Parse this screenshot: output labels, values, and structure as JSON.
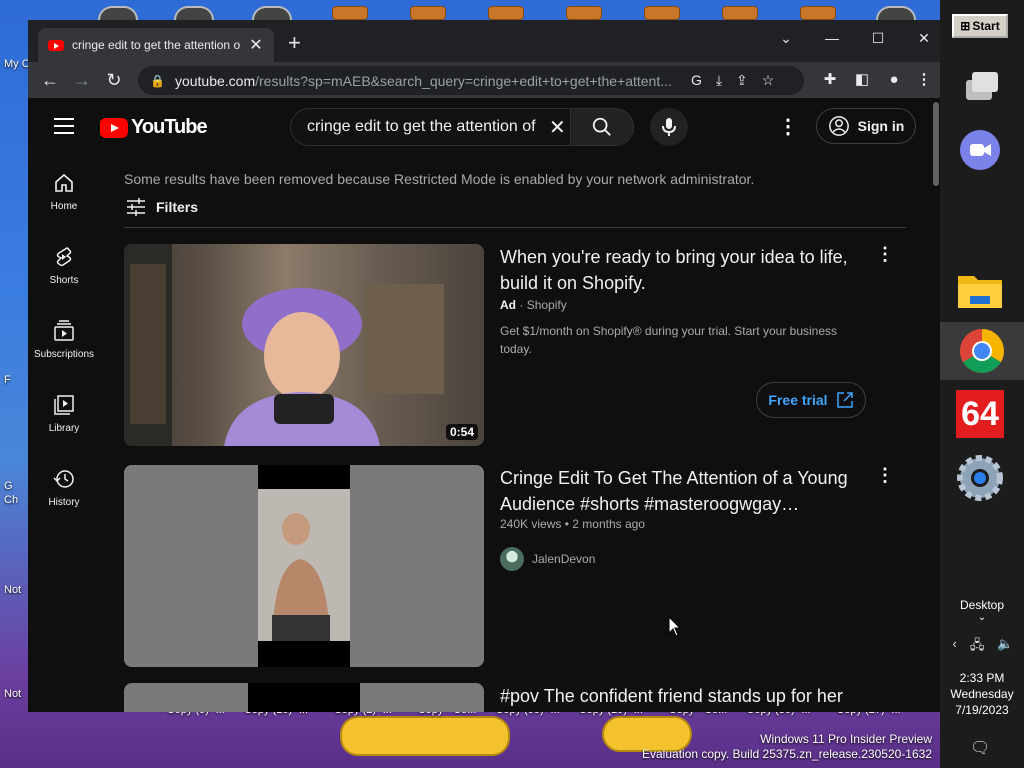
{
  "desktop": {
    "left_labels": [
      "My C",
      "F",
      "G",
      "Ch",
      "Not",
      "Not"
    ],
    "bottom_labels": [
      "- Copy (5) -...",
      "Copy (10) -...",
      "- Copy (2) -...",
      "- Copy - Co...",
      "Copy (99) -...",
      "Copy (19) -...",
      "- Copy - Co...",
      "Copy (30) -...",
      "- Copy (27) -..."
    ],
    "watermark_line1": "Windows 11 Pro Insider Preview",
    "watermark_line2": "Evaluation copy. Build 25375.zn_release.230520-1632"
  },
  "taskbar": {
    "start_label": "Start",
    "desktop_label": "Desktop",
    "time": "2:33 PM",
    "day": "Wednesday",
    "date": "7/19/2023",
    "badge_64": "64"
  },
  "browser": {
    "tab_title": "cringe edit to get the attention of",
    "new_tab": "+",
    "url_host": "youtube.com",
    "url_path": "/results?sp=mAEB&search_query=cringe+edit+to+get+the+attent..."
  },
  "youtube": {
    "logo_text": "YouTube",
    "search_value": "cringe edit to get the attention of",
    "signin_label": "Sign in",
    "sidebar": [
      {
        "label": "Home"
      },
      {
        "label": "Shorts"
      },
      {
        "label": "Subscriptions"
      },
      {
        "label": "Library"
      },
      {
        "label": "History"
      }
    ],
    "notice": "Some results have been removed because Restricted Mode is enabled by your network administrator.",
    "filters_label": "Filters",
    "results": [
      {
        "title_line1": "When you're ready to bring your idea to life,",
        "title_line2": "build it on Shopify.",
        "ad_label": "Ad",
        "advertiser": "Shopify",
        "desc_line1": "Get $1/month on Shopify® during your trial. Start your business",
        "desc_line2": "today.",
        "cta": "Free trial",
        "duration": "0:54"
      },
      {
        "title_line1": "Cringe Edit To Get The Attention of a Young",
        "title_line2": "Audience #shorts #masteroogwgay…",
        "views": "240K views",
        "age": "2 months ago",
        "channel": "JalenDevon"
      },
      {
        "title_line1": "#pov The confident friend stands up for her"
      }
    ]
  }
}
